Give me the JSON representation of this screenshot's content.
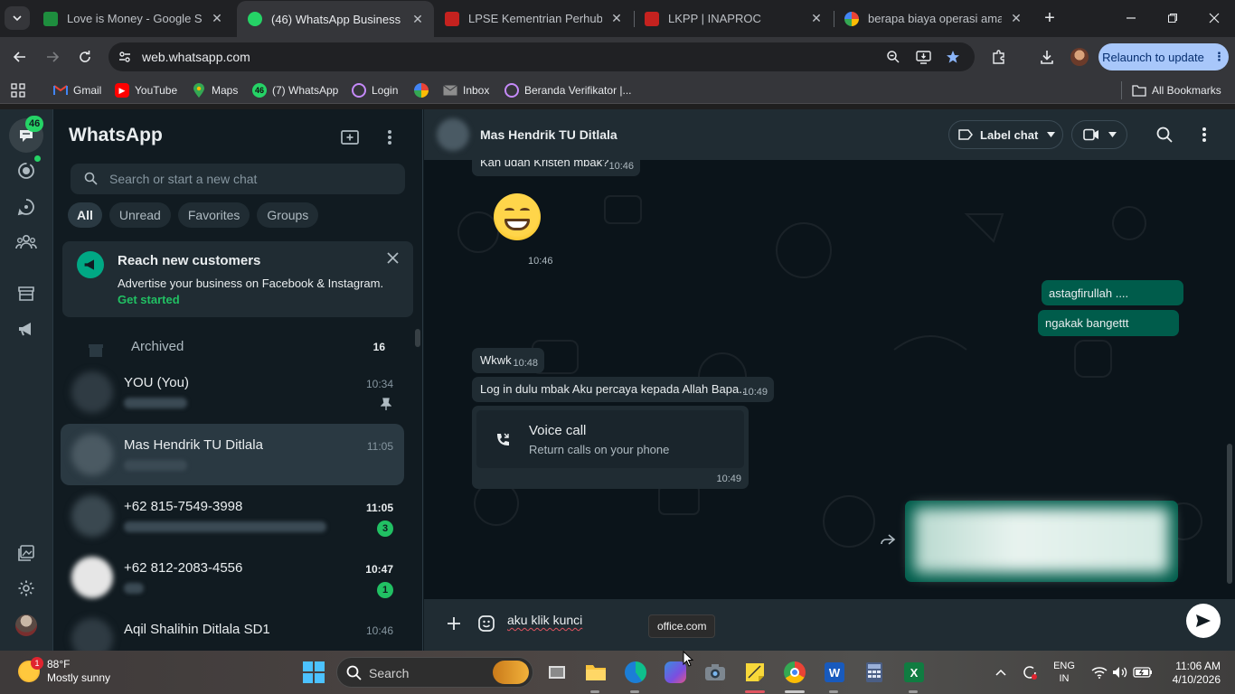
{
  "browser": {
    "tabs": [
      {
        "title": "Love is Money - Google Spreadsheets",
        "favicon": "sheets-icon",
        "color": "#1e8e3e"
      },
      {
        "title": "(46) WhatsApp Business",
        "favicon": "whatsapp-business-icon",
        "color": "#25d366",
        "badge": "46"
      },
      {
        "title": "LPSE Kementrian Perhubungan",
        "favicon": "lpse-icon",
        "color": "#c5221f"
      },
      {
        "title": "LKPP | INAPROC",
        "favicon": "lkpp-icon",
        "color": "#c5221f"
      },
      {
        "title": "berapa biaya operasi amandel",
        "favicon": "google-icon",
        "color": "#4285f4"
      }
    ],
    "url": "web.whatsapp.com",
    "relaunch_label": "Relaunch to update",
    "bookmarks": [
      {
        "label": "Gmail",
        "icon": "gmail-icon"
      },
      {
        "label": "YouTube",
        "icon": "youtube-icon"
      },
      {
        "label": "Maps",
        "icon": "maps-icon"
      },
      {
        "label": "(7) WhatsApp",
        "icon": "whatsapp-icon",
        "badge": "46"
      },
      {
        "label": "Login",
        "icon": "login-icon"
      },
      {
        "label": "",
        "icon": "photos-icon"
      },
      {
        "label": "Inbox",
        "icon": "inbox-icon"
      },
      {
        "label": "Beranda Verifikator |...",
        "icon": "verifikator-icon"
      }
    ],
    "all_bookmarks_label": "All Bookmarks"
  },
  "whatsapp": {
    "rail": {
      "chats_badge": "46"
    },
    "sidebar": {
      "title": "WhatsApp",
      "search_placeholder": "Search or start a new chat",
      "filters": [
        "All",
        "Unread",
        "Favorites",
        "Groups"
      ],
      "promo": {
        "title": "Reach new customers",
        "text": "Advertise your business on Facebook & Instagram.",
        "link": "Get started"
      },
      "archived": {
        "label": "Archived",
        "count": "16"
      },
      "chats": [
        {
          "name": "YOU (You)",
          "time": "10:34",
          "pinned": true,
          "unread": ""
        },
        {
          "name": "Mas Hendrik TU Ditlala",
          "time": "11:05",
          "pinned": false,
          "unread": ""
        },
        {
          "name": "+62 815-7549-3998",
          "time": "11:05",
          "pinned": false,
          "unread": "3"
        },
        {
          "name": "+62 812-2083-4556",
          "time": "10:47",
          "pinned": false,
          "unread": "1"
        },
        {
          "name": "Aqil Shalihin Ditlala SD1",
          "time": "10:46",
          "pinned": false,
          "unread": ""
        }
      ]
    },
    "conversation": {
      "contact_name": "Mas Hendrik TU Ditlala",
      "label_chat": "Label chat",
      "messages": [
        {
          "dir": "in",
          "text": "Kan udah Kristen mbak?",
          "time": "10:46"
        },
        {
          "dir": "in",
          "text": "",
          "emoji": "grinning-face",
          "time": "10:46"
        },
        {
          "dir": "out",
          "text": "astagfirullah ....",
          "time": ""
        },
        {
          "dir": "out",
          "text": "ngakak bangettt",
          "time": ""
        },
        {
          "dir": "in",
          "text": "Wkwk",
          "time": "10:48"
        },
        {
          "dir": "in",
          "text": "Log in dulu mbak Aku percaya kepada Allah Bapa..",
          "time": "10:49"
        }
      ],
      "voice_call": {
        "title": "Voice call",
        "subtitle": "Return calls on your phone",
        "time": "10:49"
      },
      "composer_text": "aku klik kunci"
    }
  },
  "tooltip": "office.com",
  "taskbar": {
    "weather_temp": "88°F",
    "weather_desc": "Mostly sunny",
    "weather_badge": "1",
    "search_placeholder": "Search",
    "lang_line1": "ENG",
    "lang_line2": "IN",
    "time": "11:06 AM",
    "date": "4/10/2026"
  }
}
